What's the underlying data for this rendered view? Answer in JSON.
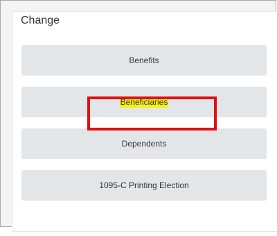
{
  "panel": {
    "title": "Change",
    "buttons": [
      {
        "label": "Benefits"
      },
      {
        "label": "Beneficiaries",
        "highlighted": true
      },
      {
        "label": "Dependents"
      },
      {
        "label": "1095-C Printing Election"
      }
    ]
  },
  "colors": {
    "button_bg": "#e3e6e8",
    "highlight": "#f4f300",
    "annotation_border": "#e01010"
  }
}
